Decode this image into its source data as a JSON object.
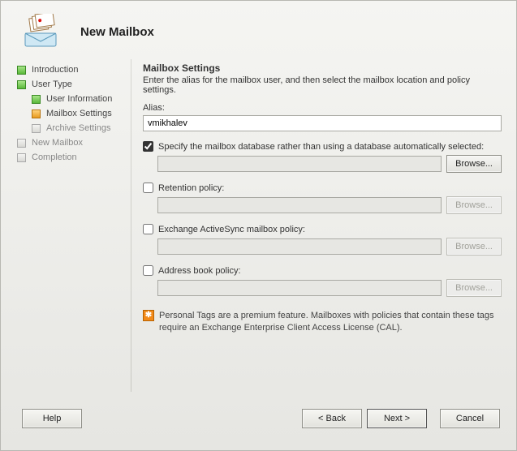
{
  "header": {
    "title": "New Mailbox"
  },
  "sidebar": {
    "items": [
      {
        "label": "Introduction"
      },
      {
        "label": "User Type"
      },
      {
        "label": "User Information"
      },
      {
        "label": "Mailbox Settings"
      },
      {
        "label": "Archive Settings"
      },
      {
        "label": "New Mailbox"
      },
      {
        "label": "Completion"
      }
    ]
  },
  "main": {
    "title": "Mailbox Settings",
    "desc": "Enter the alias for the mailbox user, and then select the mailbox location and policy settings.",
    "alias_label": "Alias:",
    "alias_value": "vmikhalev",
    "specify_db": {
      "label": "Specify the mailbox database rather than using a database automatically selected:",
      "value": "",
      "browse": "Browse..."
    },
    "retention": {
      "label": "Retention policy:",
      "value": "",
      "browse": "Browse..."
    },
    "eas": {
      "label": "Exchange ActiveSync mailbox policy:",
      "value": "",
      "browse": "Browse..."
    },
    "abp": {
      "label": "Address book policy:",
      "value": "",
      "browse": "Browse..."
    },
    "note": "Personal Tags are a premium feature. Mailboxes with policies that contain these tags require an Exchange Enterprise Client Access License (CAL)."
  },
  "footer": {
    "help": "Help",
    "back": "< Back",
    "next": "Next >",
    "cancel": "Cancel"
  }
}
